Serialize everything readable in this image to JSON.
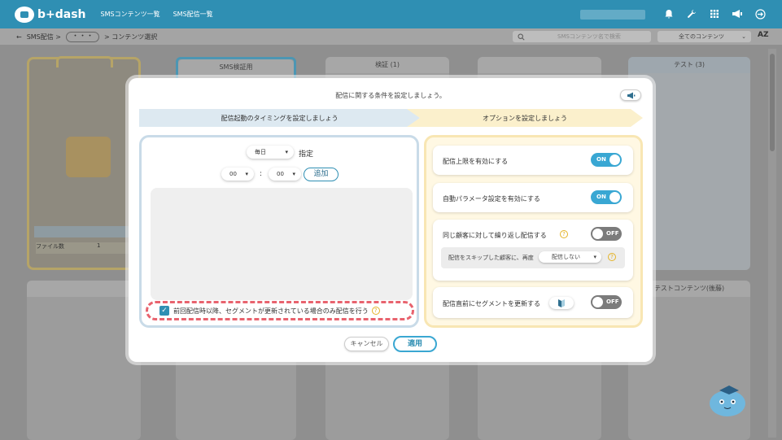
{
  "header": {
    "logo_text": "b+dash",
    "nav": [
      "SMSコンテンツ一覧",
      "SMS配信一覧"
    ],
    "icons": [
      "bell-icon",
      "wrench-icon",
      "grid-icon",
      "megaphone-icon",
      "logout-icon"
    ]
  },
  "subbar": {
    "back": "←",
    "crumb1": "SMS配信 >",
    "crumb_more": "・・・",
    "crumb2": "> コンテンツ選択",
    "search_placeholder": "SMSコンテンツ名で検索",
    "filter_value": "全てのコンテンツ",
    "sort_label": "AZ"
  },
  "background": {
    "card_titles": [
      "SMS検証用",
      "検証 (1)",
      "テスト (3)",
      "テストコンテンツ(後藤)"
    ],
    "folder_row_label": "ファイル数",
    "folder_row_value": "1"
  },
  "modal": {
    "title": "配信に関する条件を設定しましょう。",
    "step1": "配信起動のタイミングを設定しましょう",
    "step2": "オプションを設定しましょう",
    "timing": {
      "frequency": "毎日",
      "spec_label": "指定",
      "hour": "00",
      "minute": "00",
      "colon": ":",
      "add_label": "追加"
    },
    "segment_checkbox": "前回配信時以降、セグメントが更新されている場合のみ配信を行う",
    "options": {
      "limit_label": "配信上限を有効にする",
      "limit_state": "ON",
      "autoparam_label": "自動パラメータ設定を有効にする",
      "autoparam_state": "ON",
      "repeat_label": "同じ顧客に対して繰り返し配信する",
      "repeat_state": "OFF",
      "skip_text": "配信をスキップした顧客に、再度",
      "skip_select": "配信しない",
      "segment_update_label": "配信直前にセグメントを更新する",
      "segment_update_state": "OFF"
    },
    "cancel_label": "キャンセル",
    "apply_label": "適用"
  },
  "colors": {
    "brand": "#2f8fb3",
    "toggle_on": "#39a7d3",
    "toggle_off": "#7b7b7b",
    "highlight_dash": "#e8636e",
    "help": "#e4b327"
  }
}
